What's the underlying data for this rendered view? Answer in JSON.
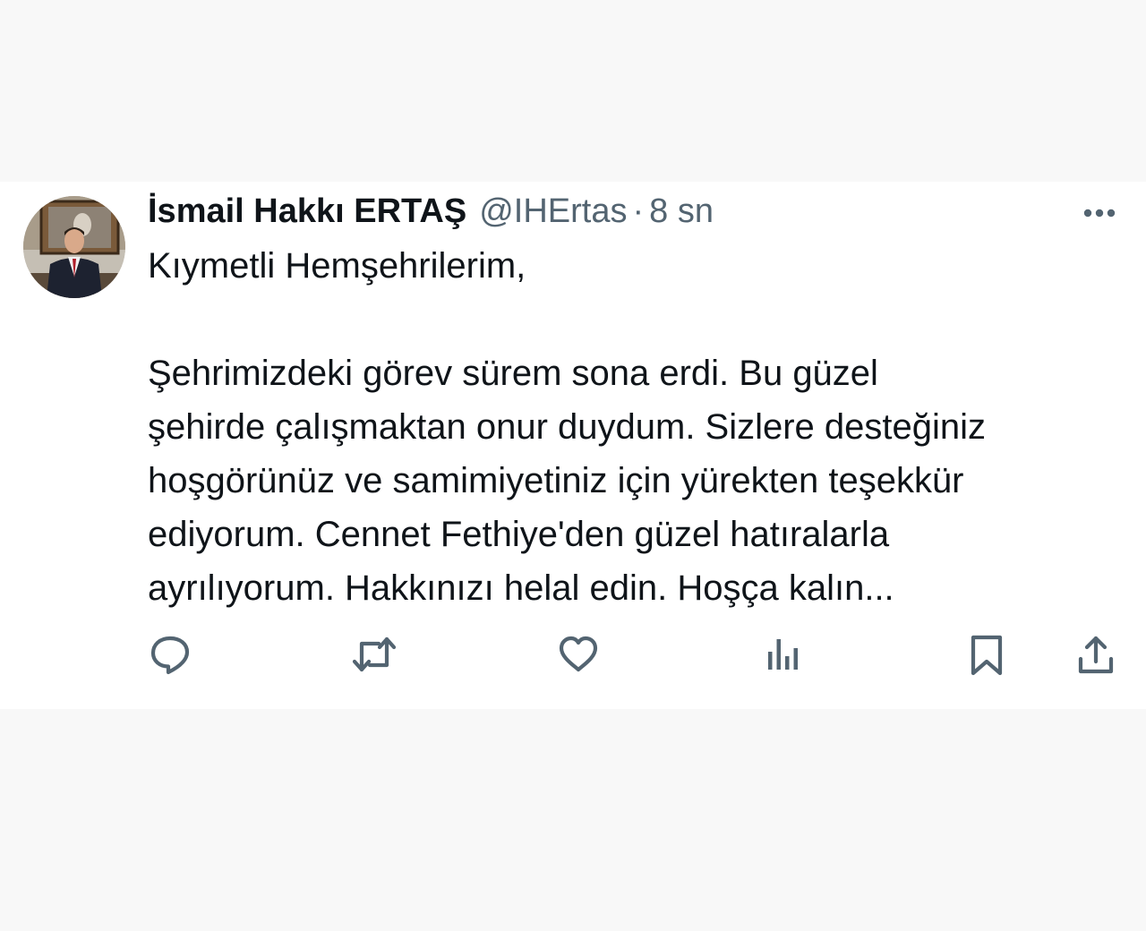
{
  "tweet": {
    "author_name": "İsmail Hakkı ERTAŞ",
    "handle": "@IHErtas",
    "separator": "·",
    "time": "8 sn",
    "greeting": "Kıymetli Hemşehrilerim,",
    "body_lines": [
      "Şehrimizdeki görev sürem sona erdi. Bu güzel",
      "şehirde çalışmaktan onur duydum. Sizlere desteğiniz",
      "hoşgörünüz ve samimiyetiniz için yürekten teşekkür",
      "ediyorum. Cennet Fethiye'den güzel hatıralarla",
      "ayrılıyorum. Hakkınızı helal edin. Hoşça kalın..."
    ]
  },
  "icons": {
    "more": "more-horizontal-icon",
    "reply": "reply-icon",
    "retweet": "retweet-icon",
    "like": "heart-icon",
    "views": "views-icon",
    "bookmark": "bookmark-icon",
    "share": "share-icon"
  },
  "colors": {
    "text_primary": "#0f1419",
    "text_secondary": "#536471",
    "icon": "#536471",
    "background": "#f8f8f8",
    "card": "#ffffff"
  }
}
